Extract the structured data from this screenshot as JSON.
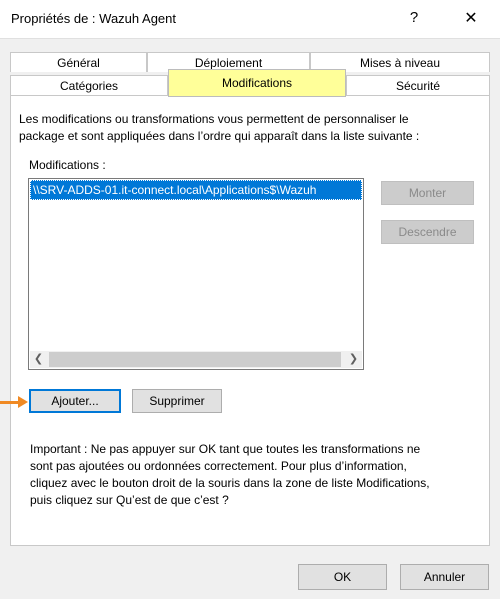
{
  "window": {
    "title": "Propriétés de : Wazuh Agent",
    "help_label": "?",
    "close_label": "✕"
  },
  "tabs": {
    "row_back": [
      "Général",
      "Déploiement",
      "Mises à niveau"
    ],
    "row_front": [
      "Catégories",
      "Modifications",
      "Sécurité"
    ],
    "active": "Modifications"
  },
  "panel": {
    "description_line1": "Les modifications ou transformations vous permettent de personnaliser le",
    "description_line2": "package et sont appliquées dans l’ordre qui apparaît dans la liste suivante :",
    "list_label": "Modifications :",
    "list_items": [
      "\\\\SRV-ADDS-01.it-connect.local\\Applications$\\Wazuh"
    ],
    "move_up_label": "Monter",
    "move_down_label": "Descendre",
    "add_label": "Ajouter...",
    "remove_label": "Supprimer",
    "important_lines": [
      "Important : Ne pas appuyer sur OK tant que toutes les transformations ne",
      "sont pas ajoutées ou ordonnées correctement. Pour plus d’information,",
      "cliquez avec le bouton droit de la souris dans la zone de liste Modifications,",
      "puis cliquez sur Qu’est de que c’est ?"
    ]
  },
  "footer": {
    "ok_label": "OK",
    "cancel_label": "Annuler"
  },
  "colors": {
    "active_tab_highlight": "#ffff99",
    "selection": "#0078d7",
    "annotation_arrow": "#f08a24"
  }
}
